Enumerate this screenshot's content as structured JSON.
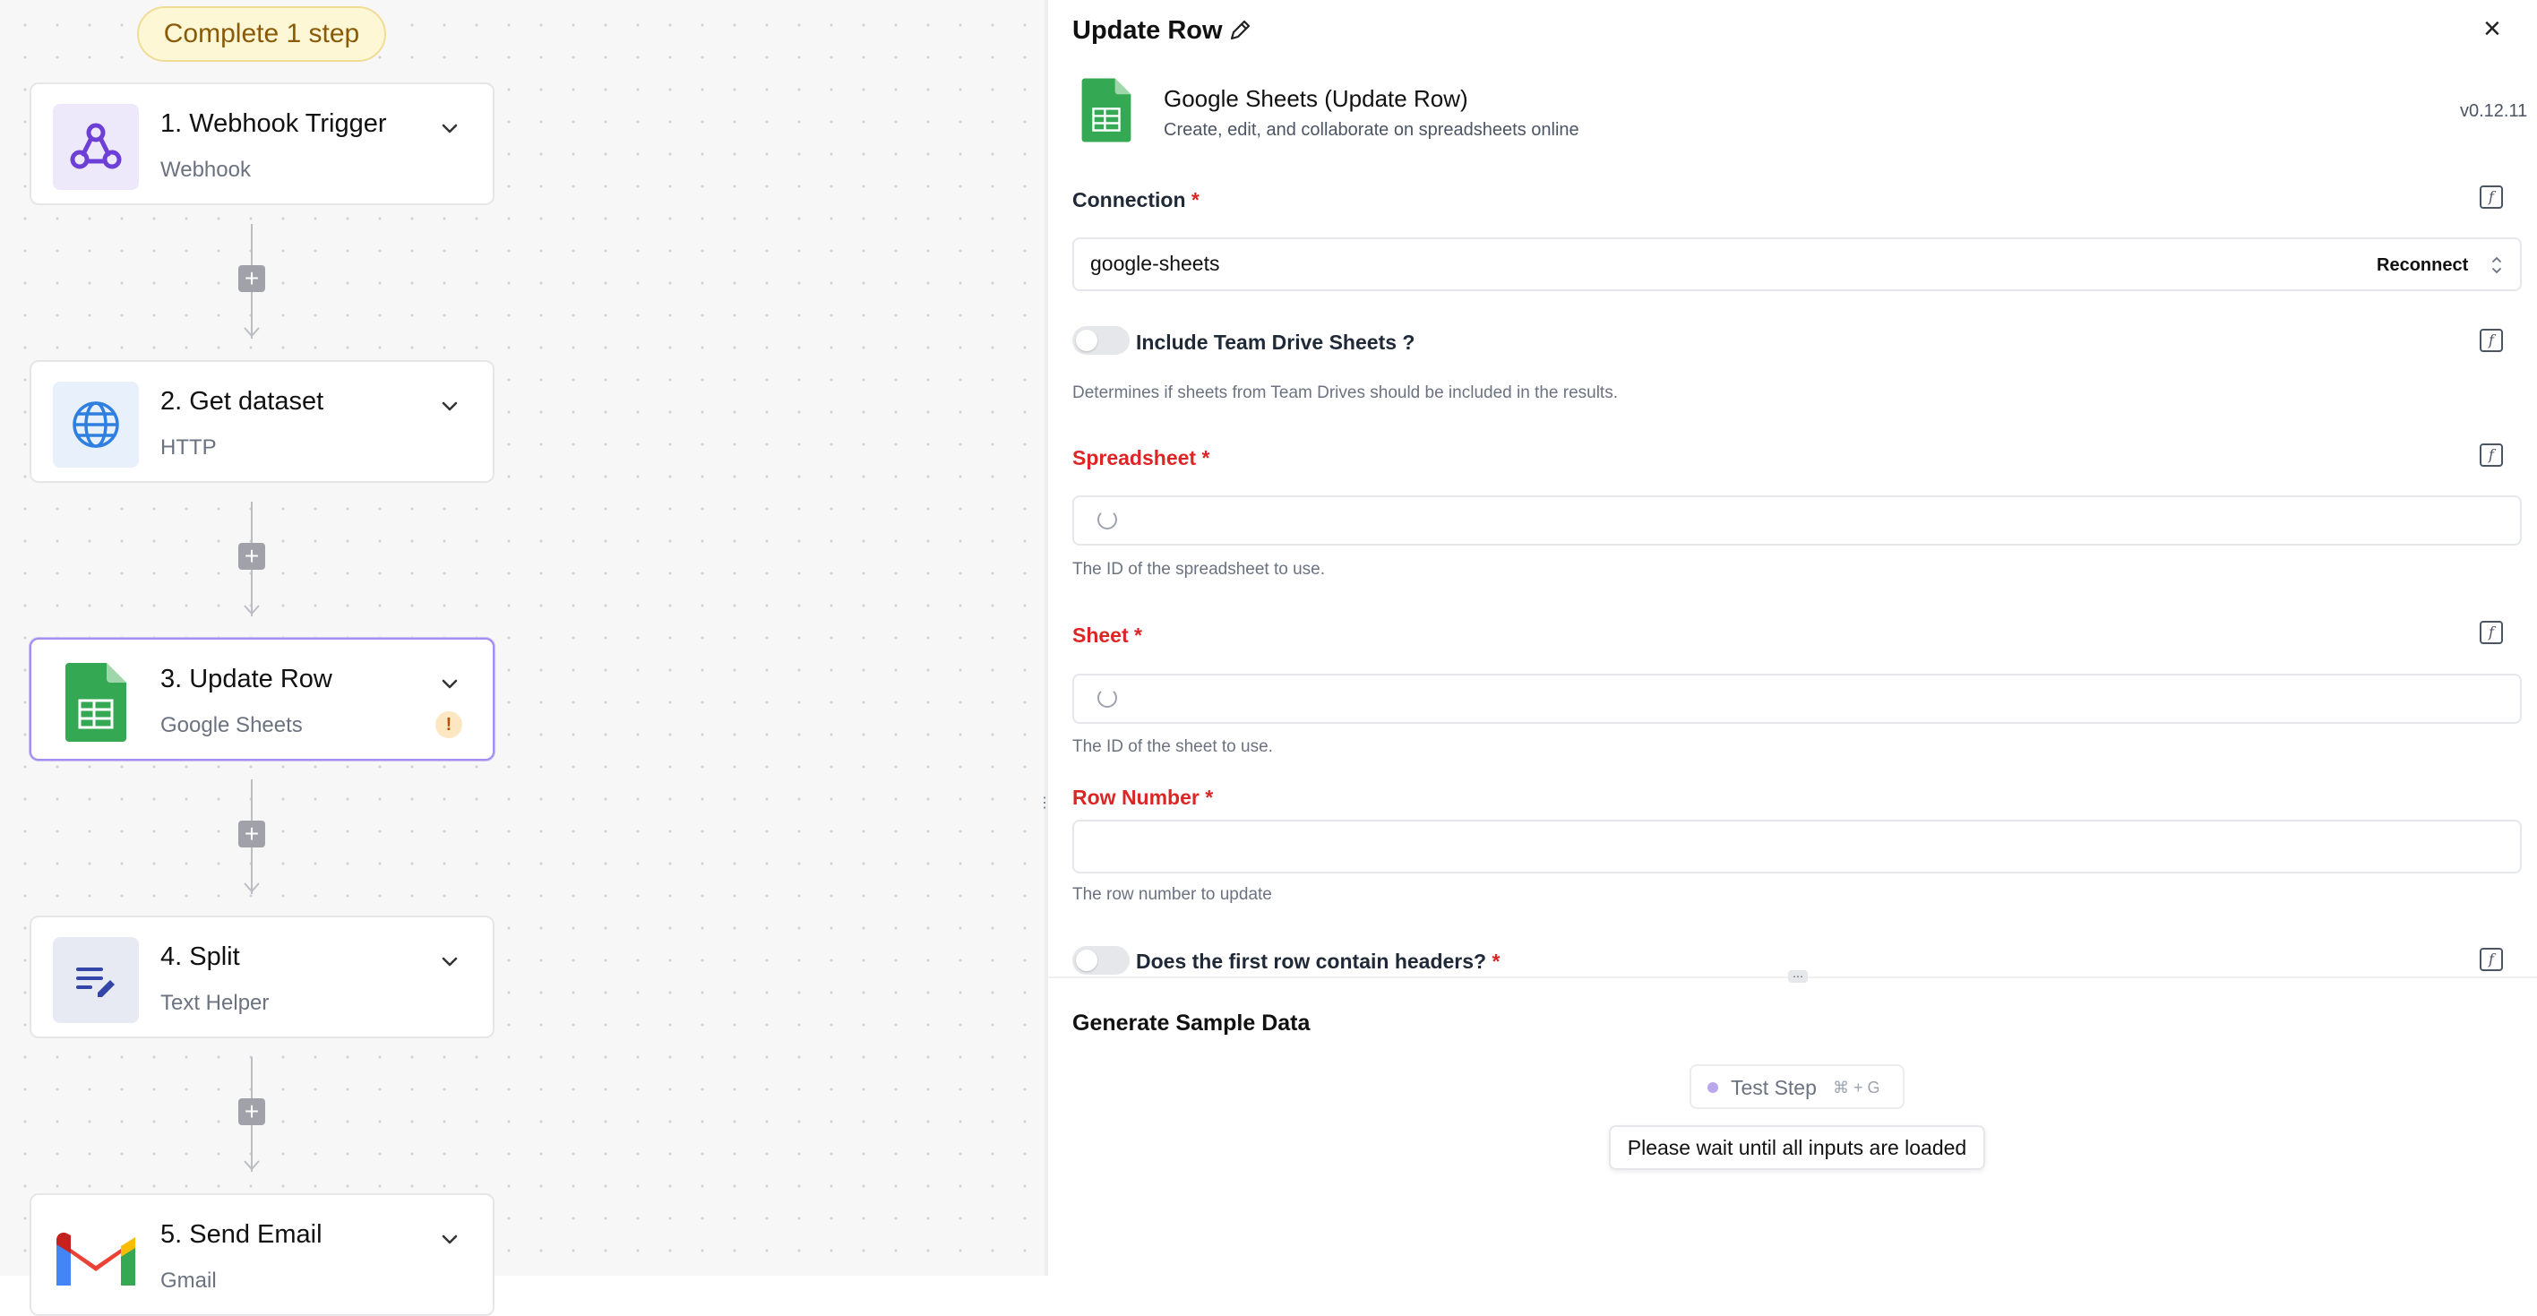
{
  "flow": {
    "badge": "Complete 1 step",
    "steps": [
      {
        "title": "1. Webhook Trigger",
        "subtitle": "Webhook",
        "icon": "webhook-icon"
      },
      {
        "title": "2. Get dataset",
        "subtitle": "HTTP",
        "icon": "globe-icon"
      },
      {
        "title": "3. Update Row",
        "subtitle": "Google Sheets",
        "icon": "google-sheets-icon",
        "warning": "!"
      },
      {
        "title": "4. Split",
        "subtitle": "Text Helper",
        "icon": "text-edit-icon"
      },
      {
        "title": "5. Send Email",
        "subtitle": "Gmail",
        "icon": "gmail-icon"
      }
    ],
    "add_button": "+"
  },
  "panel": {
    "title": "Update Row",
    "close": "×",
    "piece": {
      "name": "Google Sheets (Update Row)",
      "description": "Create, edit, and collaborate on spreadsheets online",
      "version": "v0.12.11"
    },
    "connection": {
      "label": "Connection",
      "required": "*",
      "value": "google-sheets",
      "reconnect": "Reconnect"
    },
    "team_drive": {
      "label": "Include Team Drive Sheets ?",
      "description": "Determines if sheets from Team Drives should be included in the results.",
      "enabled": false
    },
    "spreadsheet": {
      "label": "Spreadsheet",
      "required": "*",
      "description": "The ID of the spreadsheet to use."
    },
    "sheet": {
      "label": "Sheet",
      "required": "*",
      "description": "The ID of the sheet to use."
    },
    "row_number": {
      "label": "Row Number",
      "required": "*",
      "value": "",
      "description": "The row number to update"
    },
    "headers": {
      "label": "Does the first row contain headers?",
      "required": "*",
      "enabled": false
    },
    "sample": {
      "heading": "Generate Sample Data",
      "button_label": "Test Step",
      "shortcut": "⌘ + G",
      "tooltip": "Please wait until all inputs are loaded"
    },
    "fx_symbol": "f"
  },
  "colors": {
    "accent": "#a48ff0",
    "required": "#dc2626",
    "sheets_green": "#34a853"
  }
}
